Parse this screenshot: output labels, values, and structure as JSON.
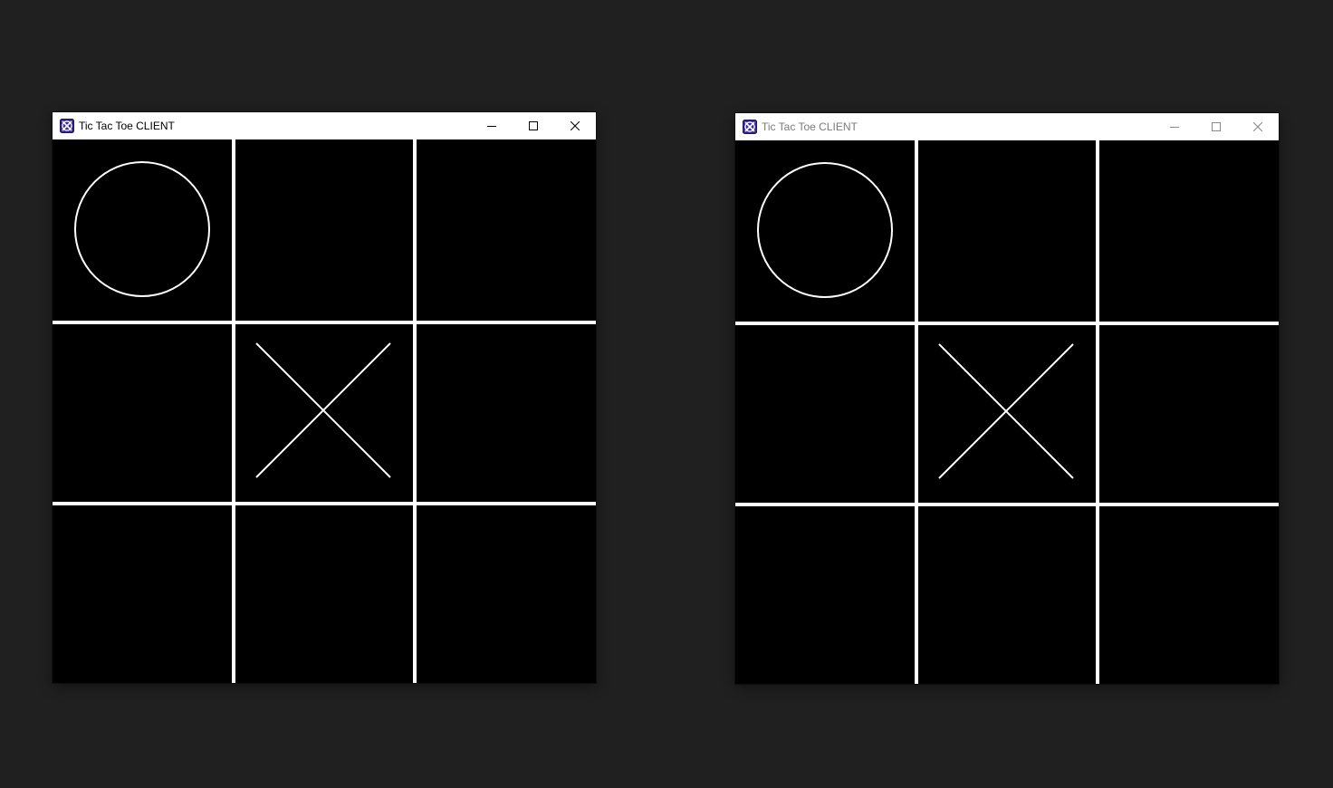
{
  "windows": [
    {
      "title": "Tic Tac Toe CLIENT",
      "active": true,
      "controls": {
        "minimize": "minimize",
        "maximize": "maximize",
        "close": "close"
      },
      "board": [
        "O",
        "",
        "",
        "",
        "X",
        "",
        "",
        "",
        ""
      ]
    },
    {
      "title": "Tic Tac Toe CLIENT",
      "active": false,
      "controls": {
        "minimize": "minimize",
        "maximize": "maximize",
        "close": "close"
      },
      "board": [
        "O",
        "",
        "",
        "",
        "X",
        "",
        "",
        "",
        ""
      ]
    }
  ],
  "colors": {
    "desktop": "#202020",
    "board_background": "#000000",
    "grid_lines": "#ffffff",
    "marks": "#ffffff",
    "titlebar": "#ffffff",
    "icon_background": "#3a2a9c",
    "icon_mark": "#ffffff"
  },
  "icons": {
    "app": "app-icon",
    "minimize": "minimize-icon",
    "maximize": "maximize-icon",
    "close": "close-icon"
  }
}
